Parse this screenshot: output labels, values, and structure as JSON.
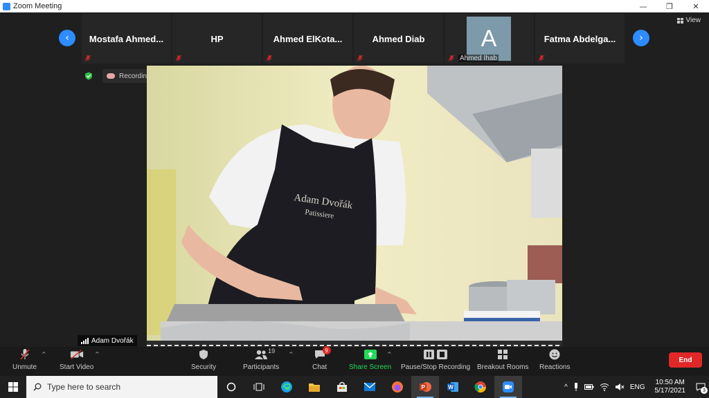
{
  "window": {
    "title": "Zoom Meeting",
    "controls": [
      "—",
      "❐",
      "✕"
    ]
  },
  "view": {
    "label": "View"
  },
  "thumbnails": [
    {
      "name": "Mostafa  Ahmed..."
    },
    {
      "name": "HP"
    },
    {
      "name": "Ahmed  ElKota..."
    },
    {
      "name": "Ahmed  Diab"
    },
    {
      "name": "Ahmed Ihab",
      "avatar": "A"
    },
    {
      "name": "Fatma  Abdelga..."
    }
  ],
  "recording": {
    "label": "Recording..."
  },
  "video": {
    "speaker": "Adam Dvořák",
    "apron_line1": "Adam Dvořák",
    "apron_line2": "Patissiere"
  },
  "toolbar": {
    "unmute": "Unmute",
    "start_video": "Start Video",
    "security": "Security",
    "participants": "Participants",
    "participants_count": "19",
    "chat": "Chat",
    "chat_badge": "9",
    "share_screen": "Share Screen",
    "pause_recording": "Pause/Stop Recording",
    "breakout_rooms": "Breakout Rooms",
    "reactions": "Reactions",
    "end": "End"
  },
  "taskbar": {
    "search_placeholder": "Type here to search",
    "language": "ENG",
    "time": "10:50 AM",
    "date": "5/17/2021",
    "notification_count": "3"
  },
  "colors": {
    "accent": "#2d8cff",
    "end": "#e02828",
    "share": "#23d959"
  }
}
